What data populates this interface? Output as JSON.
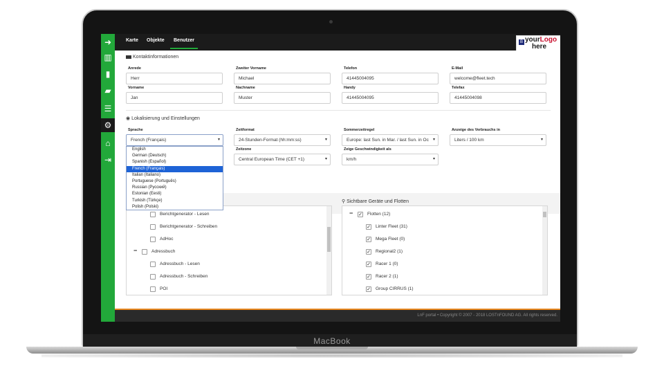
{
  "device": {
    "label": "MacBook"
  },
  "nav": {
    "tabs": [
      "Karte",
      "Objekte",
      "Benutzer"
    ],
    "active": "Benutzer"
  },
  "logo": {
    "mark": "B",
    "line1": "your",
    "line1_accent": "Logo",
    "line2": "here"
  },
  "sidebar": {
    "icons": [
      "arrow-right-icon",
      "map-icon",
      "chart-icon",
      "book-icon",
      "list-icon",
      "gear-icon",
      "bank-icon",
      "logout-icon"
    ]
  },
  "contact": {
    "title": "Kontaktinformationen",
    "labels": {
      "anrede": "Anrede",
      "zweiter_vorname": "Zweiter Vorname",
      "telefon": "Telefon",
      "email": "E-Mail",
      "vorname": "Vorname",
      "nachname": "Nachname",
      "handy": "Handy",
      "telefax": "Telefax"
    },
    "values": {
      "anrede": "Herr",
      "zweiter_vorname": "Michael",
      "telefon": "41445004095",
      "email": "welcome@fleet.tech",
      "vorname": "Jan",
      "nachname": "Muster",
      "handy": "41445004095",
      "telefax": "41445004098"
    }
  },
  "localization": {
    "title": "Lokalisierung und Einstellungen",
    "labels": {
      "sprache": "Sprache",
      "zeitformat": "Zeitformat",
      "sommerzeitregel": "Sommerzeitregel",
      "verbrauch": "Anzeige des Verbrauchs in",
      "zeitzone": "Zeitzone",
      "geschwindigkeit": "Zeige Geschwindigkeit als"
    },
    "values": {
      "sprache": "French (Français)",
      "zeitformat": "24-Stunden-Format (hh:mm:ss)",
      "sommerzeitregel": "Europe: last Sun. in Mar. / last Sun. in Oc",
      "verbrauch": "Liters / 100 km",
      "zeitzone": "Central European Time (CET +1)",
      "geschwindigkeit": "km/h"
    },
    "language_options": [
      "English",
      "German (Deutsch)",
      "Spanish (Español)",
      "French (Français)",
      "Italian (Italiano)",
      "Portuguese (Português)",
      "Russian (Русский)",
      "Estonian (Eesti)",
      "Turkish (Türkçe)",
      "Polish (Polski)"
    ],
    "selected_index": 3
  },
  "permissions": {
    "rows": [
      {
        "label": "Berichtgenerator - Lesen",
        "checked": false
      },
      {
        "label": "Berichtgenerator - Schreiben",
        "checked": false
      },
      {
        "label": "AdHoc",
        "checked": false
      },
      {
        "label": "Adressbuch",
        "checked": false
      },
      {
        "label": "Adressbuch - Lesen",
        "checked": false
      },
      {
        "label": "Adressbuch - Schreiben",
        "checked": false
      },
      {
        "label": "POI",
        "checked": false
      }
    ]
  },
  "fleets": {
    "title": "Sichtbare Geräte und Flotten",
    "rows": [
      {
        "label": "Flotten (12)",
        "checked": true
      },
      {
        "label": "Linter Fleet (31)",
        "checked": true
      },
      {
        "label": "Mega Fleet (0)",
        "checked": true
      },
      {
        "label": "Regional2 (1)",
        "checked": true
      },
      {
        "label": "Racer 1 (0)",
        "checked": true
      },
      {
        "label": "Racer 2 (1)",
        "checked": true
      },
      {
        "label": "Group CIRRUS (1)",
        "checked": true
      }
    ]
  },
  "footer": {
    "text": "LnF portal • Copyright © 2007 - 2018 LOSTnFOUND AG. All rights reserved."
  },
  "colors": {
    "accent": "#22a83a",
    "footer_line": "#e8871e",
    "selection": "#1e63d6"
  }
}
